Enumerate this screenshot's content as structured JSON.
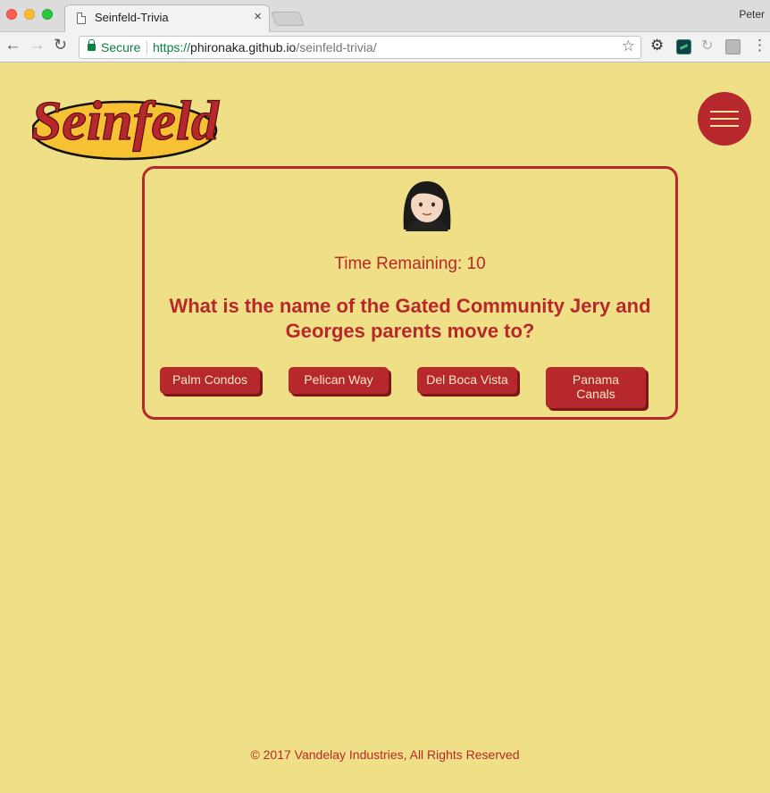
{
  "browser": {
    "tab_title": "Seinfeld-Trivia",
    "tab_close": "×",
    "profile_name": "Peter",
    "secure_label": "Secure",
    "url_scheme": "https://",
    "url_host": "phironaka.github.io",
    "url_path": "/seinfeld-trivia/",
    "back_glyph": "←",
    "forward_glyph": "→",
    "reload_glyph": "↻",
    "star_glyph": "☆",
    "menu_glyph": "⋮"
  },
  "header": {
    "logo_text": "Seinfeld",
    "menu_icon": "hamburger-icon"
  },
  "trivia": {
    "character_icon": "woman-emoji-icon",
    "timer_label": "Time Remaining: 10",
    "question": "What is the name of the Gated Community Jery and Georges parents move to?",
    "answers": [
      "Palm Condos",
      "Pelican Way",
      "Del Boca Vista",
      "Panama Canals"
    ]
  },
  "footer": {
    "text": "© 2017 Vandelay Industries, All Rights Reserved"
  },
  "colors": {
    "background": "#efdf86",
    "accent": "#b7282c",
    "secure_green": "#0b8043"
  }
}
